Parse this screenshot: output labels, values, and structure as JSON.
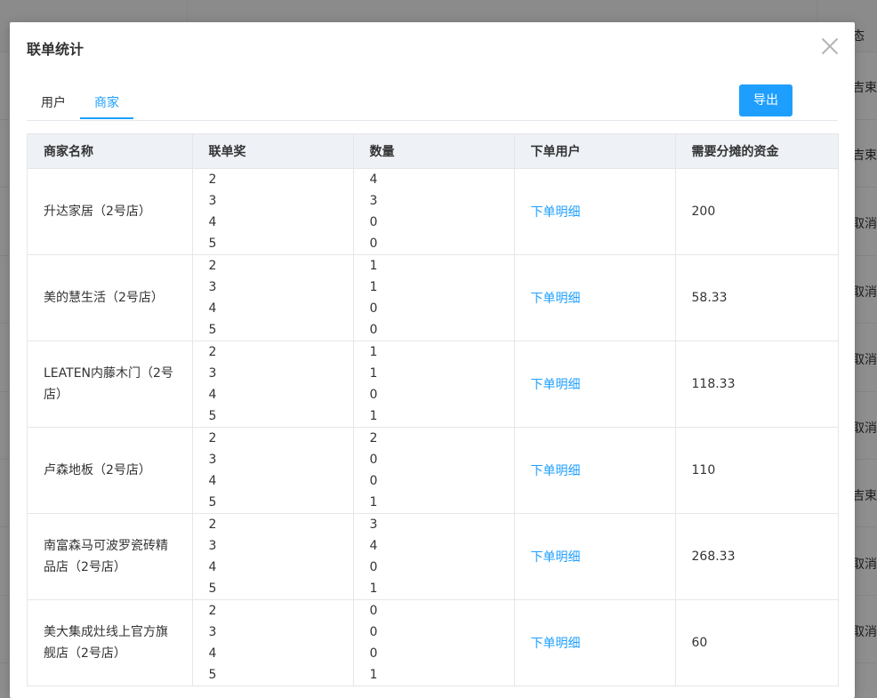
{
  "background_right_cells": [
    "态",
    "吉束",
    "吉束",
    "取消",
    "取消",
    "取消",
    "取消",
    "吉束",
    "取消",
    "取消"
  ],
  "modal": {
    "title": "联单统计",
    "close_icon": "close-icon",
    "tabs": [
      {
        "label": "用户",
        "active": false
      },
      {
        "label": "商家",
        "active": true
      }
    ],
    "export_label": "导出"
  },
  "table": {
    "headers": [
      "商家名称",
      "联单奖",
      "数量",
      "下单用户",
      "需要分摊的资金"
    ],
    "rows": [
      {
        "name": "升达家居（2号店）",
        "awards": [
          "2",
          "3",
          "4",
          "5"
        ],
        "counts": [
          "4",
          "3",
          "0",
          "0"
        ],
        "link": "下单明细",
        "amount": "200"
      },
      {
        "name": "美的慧生活（2号店）",
        "awards": [
          "2",
          "3",
          "4",
          "5"
        ],
        "counts": [
          "1",
          "1",
          "0",
          "0"
        ],
        "link": "下单明细",
        "amount": "58.33"
      },
      {
        "name": "LEATEN内藤木门（2号店）",
        "awards": [
          "2",
          "3",
          "4",
          "5"
        ],
        "counts": [
          "1",
          "1",
          "0",
          "1"
        ],
        "link": "下单明细",
        "amount": "118.33"
      },
      {
        "name": "卢森地板（2号店）",
        "awards": [
          "2",
          "3",
          "4",
          "5"
        ],
        "counts": [
          "2",
          "0",
          "0",
          "1"
        ],
        "link": "下单明细",
        "amount": "110"
      },
      {
        "name": "南富森马可波罗瓷砖精品店（2号店）",
        "awards": [
          "2",
          "3",
          "4",
          "5"
        ],
        "counts": [
          "3",
          "4",
          "0",
          "1"
        ],
        "link": "下单明细",
        "amount": "268.33"
      },
      {
        "name": "美大集成灶线上官方旗舰店（2号店）",
        "awards": [
          "2",
          "3",
          "4",
          "5"
        ],
        "counts": [
          "0",
          "0",
          "0",
          "1"
        ],
        "link": "下单明细",
        "amount": "60"
      }
    ]
  },
  "colors": {
    "accent": "#1e9fff",
    "header_bg": "#eef1f6",
    "border": "#e6e6e6"
  }
}
